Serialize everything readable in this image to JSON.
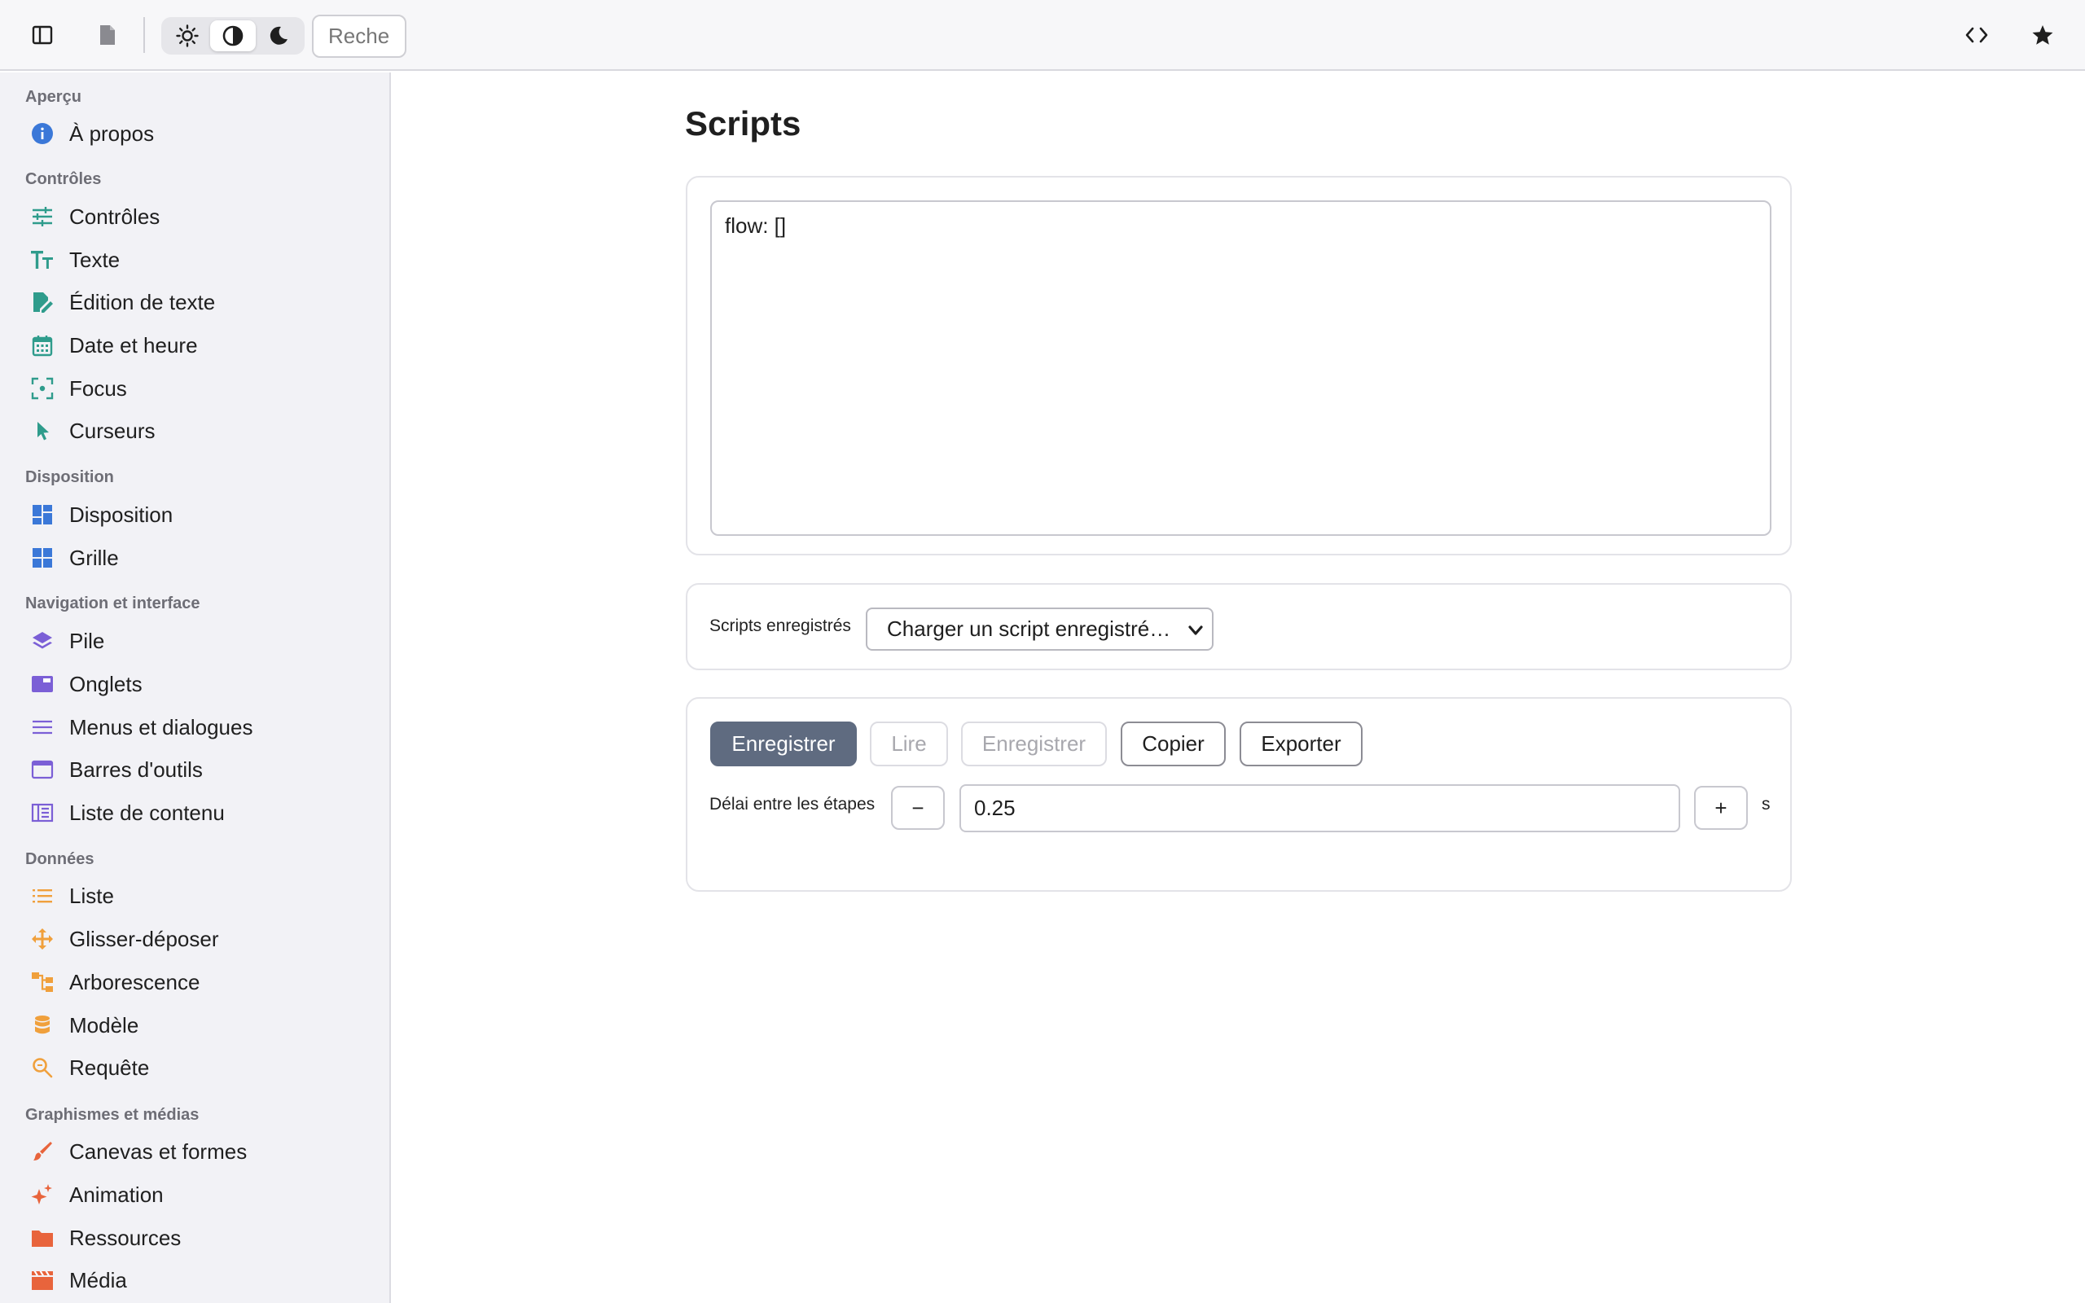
{
  "toolbar": {
    "search_placeholder": "Recherc",
    "theme_options": [
      "light",
      "auto",
      "dark"
    ],
    "active_theme": "auto"
  },
  "sidebar": {
    "sections": [
      {
        "title": "Aperçu",
        "items": [
          {
            "label": "À propos",
            "icon": "info-icon",
            "color": "#3b78d8"
          }
        ]
      },
      {
        "title": "Contrôles",
        "items": [
          {
            "label": "Contrôles",
            "icon": "sliders-icon",
            "color": "#2f9c8c"
          },
          {
            "label": "Texte",
            "icon": "text-icon",
            "color": "#2f9c8c"
          },
          {
            "label": "Édition de texte",
            "icon": "edit-document-icon",
            "color": "#2f9c8c"
          },
          {
            "label": "Date et heure",
            "icon": "calendar-icon",
            "color": "#2f9c8c"
          },
          {
            "label": "Focus",
            "icon": "focus-icon",
            "color": "#2f9c8c"
          },
          {
            "label": "Curseurs",
            "icon": "pointer-icon",
            "color": "#2f9c8c"
          }
        ]
      },
      {
        "title": "Disposition",
        "items": [
          {
            "label": "Disposition",
            "icon": "dashboard-icon",
            "color": "#3b78d8"
          },
          {
            "label": "Grille",
            "icon": "grid-icon",
            "color": "#3b78d8"
          }
        ]
      },
      {
        "title": "Navigation et interface",
        "items": [
          {
            "label": "Pile",
            "icon": "layers-icon",
            "color": "#7b5fd6"
          },
          {
            "label": "Onglets",
            "icon": "tab-icon",
            "color": "#7b5fd6"
          },
          {
            "label": "Menus et dialogues",
            "icon": "menu-icon",
            "color": "#7b5fd6"
          },
          {
            "label": "Barres d'outils",
            "icon": "toolbar-icon",
            "color": "#7b5fd6"
          },
          {
            "label": "Liste de contenu",
            "icon": "content-list-icon",
            "color": "#7b5fd6"
          }
        ]
      },
      {
        "title": "Données",
        "items": [
          {
            "label": "Liste",
            "icon": "list-icon",
            "color": "#f0a03c"
          },
          {
            "label": "Glisser-déposer",
            "icon": "move-icon",
            "color": "#f0a03c"
          },
          {
            "label": "Arborescence",
            "icon": "tree-icon",
            "color": "#f0a03c"
          },
          {
            "label": "Modèle",
            "icon": "database-icon",
            "color": "#f0a03c"
          },
          {
            "label": "Requête",
            "icon": "search-icon",
            "color": "#f0a03c"
          }
        ]
      },
      {
        "title": "Graphismes et médias",
        "items": [
          {
            "label": "Canevas et formes",
            "icon": "brush-icon",
            "color": "#e8643c"
          },
          {
            "label": "Animation",
            "icon": "sparkle-icon",
            "color": "#e8643c"
          },
          {
            "label": "Ressources",
            "icon": "folder-icon",
            "color": "#e8643c"
          },
          {
            "label": "Média",
            "icon": "clapperboard-icon",
            "color": "#e8643c"
          }
        ]
      }
    ]
  },
  "main": {
    "title": "Scripts",
    "script_text": "flow: []",
    "saved": {
      "label": "Scripts enregistrés",
      "select_value": "Charger un script enregistré…"
    },
    "actions": {
      "record": "Enregistrer",
      "play": "Lire",
      "save": "Enregistrer",
      "copy": "Copier",
      "export": "Exporter"
    },
    "delay": {
      "label": "Délai entre les étapes",
      "minus": "−",
      "value": "0.25",
      "plus": "+",
      "unit": "s"
    }
  }
}
